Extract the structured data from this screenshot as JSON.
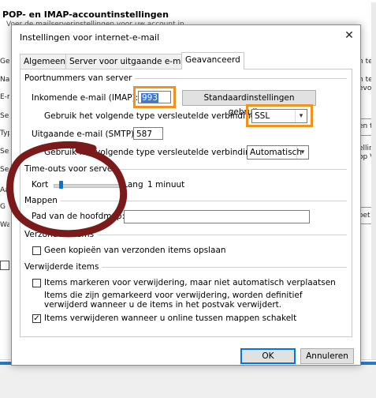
{
  "background": {
    "title": "POP- en IMAP-accountinstellingen",
    "subtitle": "Voer de mailserverinstellingen voor uw account in",
    "left_fragments": [
      "Gel",
      "Naa",
      "E-m",
      "Ser",
      "Typ",
      "Ser",
      "Se",
      "Aar",
      "G",
      "Wa"
    ],
    "right_fragments": [
      "n tes",
      "n te c",
      "evoe",
      "en te",
      "elling",
      "op Vo",
      "oet b"
    ]
  },
  "dialog": {
    "title": "Instellingen voor internet-e-mail",
    "close_label": "✕",
    "tabs": [
      "Algemeen",
      "Server voor uitgaande e-mail",
      "Geavanceerd"
    ],
    "ports": {
      "section": "Poortnummers van server",
      "incoming_label": "Inkomende e-mail (IMAP):",
      "incoming_value": "993",
      "defaults_button": "Standaardinstellingen gebruiken",
      "incoming_encryption_label": "Gebruik het volgende type versleutelde verbinding:",
      "incoming_encryption_value": "SSL",
      "outgoing_label": "Uitgaande e-mail (SMTP):",
      "outgoing_value": "587",
      "outgoing_encryption_label": "Gebruik het volgende type versleutelde verbinding:",
      "outgoing_encryption_value": "Automatisch"
    },
    "timeouts": {
      "section": "Time-outs voor server",
      "short_label": "Kort",
      "long_label": "Lang",
      "value": "1 minuut",
      "slider_level": 0.08
    },
    "folders": {
      "section": "Mappen",
      "root_path_label": "Pad van de hoofdmap:",
      "root_path_value": ""
    },
    "sent": {
      "section": "Verzonden items",
      "no_copies_label": "Geen kopieën van verzonden items opslaan",
      "no_copies_checked": false
    },
    "deleted": {
      "section": "Verwijderde items",
      "mark_label": "Items markeren voor verwijdering, maar niet automatisch verplaatsen",
      "mark_checked": false,
      "note_line1": "Items die zijn gemarkeerd voor verwijdering, worden definitief",
      "note_line2": "verwijderd wanneer u de items in het postvak verwijdert.",
      "purge_label": "Items verwijderen wanneer u online tussen mappen schakelt",
      "purge_checked": true
    },
    "ok_button": "OK",
    "cancel_button": "Annuleren"
  },
  "colors": {
    "highlight_border": "#f0921e",
    "annotation_circle": "#7a1a1a",
    "accent": "#0078d7"
  }
}
